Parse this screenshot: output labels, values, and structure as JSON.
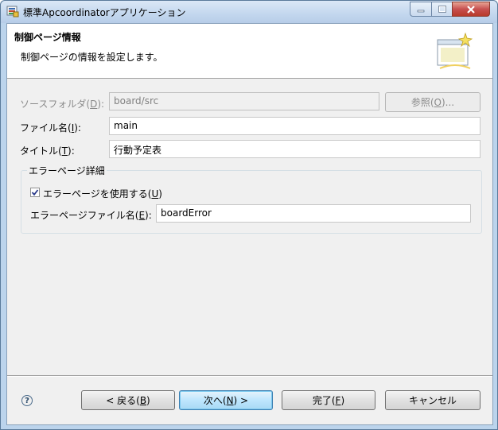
{
  "window": {
    "title": "標準Apcoordinatorアプリケーション"
  },
  "banner": {
    "title": "制御ページ情報",
    "description": "制御ページの情報を設定します。"
  },
  "form": {
    "source_folder_label": "ソースフォルダ(",
    "source_folder_key": "D",
    "source_folder_suffix": "):",
    "source_folder_value": "board/src",
    "browse_label": "参照(",
    "browse_key": "O",
    "browse_suffix": ")...",
    "file_name_label": "ファイル名(",
    "file_name_key": "I",
    "file_name_suffix": "):",
    "file_name_value": "main",
    "title_label": "タイトル(",
    "title_key": "T",
    "title_suffix": "):",
    "title_value": "行動予定表"
  },
  "error_group": {
    "title": "エラーページ詳細",
    "use_label": "エラーページを使用する(",
    "use_key": "U",
    "use_suffix": ")",
    "use_checked": true,
    "file_label": "エラーページファイル名(",
    "file_key": "E",
    "file_suffix": "):",
    "file_value": "boardError"
  },
  "footer": {
    "back_label": "< 戻る(",
    "back_key": "B",
    "back_suffix": ")",
    "next_label": "次へ(",
    "next_key": "N",
    "next_suffix": ") >",
    "finish_label": "完了(",
    "finish_key": "F",
    "finish_suffix": ")",
    "cancel_label": "キャンセル"
  },
  "icons": {
    "app": "app-icon",
    "minimize": "minimize-icon",
    "maximize": "maximize-icon",
    "close": "close-icon",
    "banner": "wizard-banner-icon",
    "help": "help-icon",
    "check": "checkmark-icon"
  }
}
